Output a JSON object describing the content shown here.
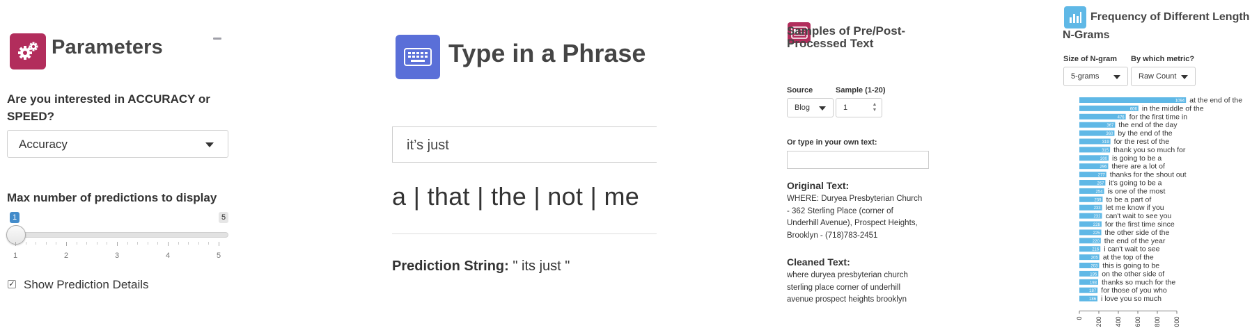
{
  "parameters": {
    "title": "Parameters",
    "icon": "gears-icon",
    "accuracy_question": "Are you interested in ACCURACY or SPEED?",
    "accuracy_value": "Accuracy",
    "max_predictions_label": "Max number of predictions to display",
    "slider": {
      "min": 1,
      "max": 5,
      "value": 1,
      "min_label": "1",
      "max_label": "5",
      "tick_labels": [
        "1",
        "2",
        "3",
        "4",
        "5"
      ]
    },
    "show_details_label": "Show Prediction Details",
    "show_details_checked": true
  },
  "phrase": {
    "title": "Type in a Phrase",
    "icon": "keyboard-icon",
    "input_value": "it’s just",
    "predictions_text": "a | that | the | not | me",
    "prediction_string_label": "Prediction String:",
    "prediction_string_value": " \" its just \""
  },
  "samples": {
    "title": "Samples of Pre/Post-Processed Text",
    "icon": "newspaper-icon",
    "source_label": "Source",
    "source_value": "Blog",
    "sample_label": "Sample (1-20)",
    "sample_value": "1",
    "own_text_label": "Or type in your own text:",
    "own_text_value": "",
    "original_heading": "Original Text:",
    "original_text": "WHERE: Duryea Presbyterian Church - 362 Sterling Place (corner of Underhill Avenue), Prospect Heights, Brooklyn - (718)783-2451",
    "cleaned_heading": "Cleaned Text:",
    "cleaned_text": "where duryea presbyterian church sterling place corner of underhill avenue prospect heights brooklyn"
  },
  "frequency": {
    "title": "Frequency of Different Length N-Grams",
    "icon": "bar-chart-icon",
    "size_label": "Size of N-gram",
    "size_value": "5-grams",
    "metric_label": "By which metric?",
    "metric_value": "Raw Count"
  },
  "colors": {
    "accent_red": "#b22d5c",
    "accent_blue": "#5a6fd8",
    "bar_blue": "#5fb8e6",
    "slider_blue": "#428bca"
  },
  "chart_data": {
    "type": "bar",
    "orientation": "horizontal",
    "categories": [
      "at the end of the",
      "in the middle of the",
      "for the first time in",
      "the end of the day",
      "by the end of the",
      "for the rest of the",
      "thank you so much for",
      "is going to be a",
      "there are a lot of",
      "thanks for the shout out",
      "it's going to be a",
      "is one of the most",
      "to be a part of",
      "let me know if you",
      "can't wait to see you",
      "for the first time since",
      "the other side of the",
      "the end of the year",
      "i can't wait to see",
      "at the top of the",
      "this is going to be",
      "on the other side of",
      "thanks so much for the",
      "for those of you who",
      "i love you so much"
    ],
    "values": [
      1094,
      606,
      476,
      367,
      360,
      319,
      315,
      300,
      296,
      277,
      267,
      254,
      239,
      233,
      232,
      228,
      225,
      220,
      216,
      205,
      203,
      195,
      193,
      187,
      186
    ],
    "value_labels": [
      "1094",
      "606",
      "476",
      "367",
      "360",
      "319",
      "315",
      "300",
      "296",
      "277",
      "267",
      "254",
      "239",
      "233",
      "232",
      "228",
      "225",
      "220",
      "216",
      "205",
      "203",
      "195",
      "193",
      "187",
      "186"
    ],
    "xlim": [
      0,
      1000
    ],
    "x_ticks": [
      "0",
      "200",
      "400",
      "600",
      "800",
      "000"
    ]
  }
}
